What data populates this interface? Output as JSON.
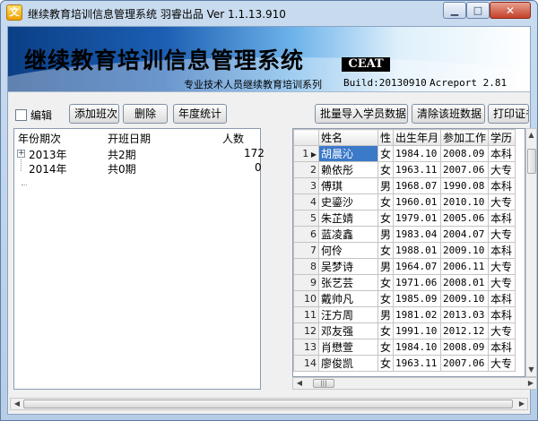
{
  "window": {
    "title": "继续教育培训信息管理系统  羽睿出品    Ver 1.1.13.910",
    "app_icon_glyph": "文"
  },
  "banner": {
    "title": "继续教育培训信息管理系统",
    "badge": "CEAT",
    "subtitle": "专业技术人员继续教育培训系列",
    "build": "Build:20130910",
    "acreport": "Acreport 2.81"
  },
  "toolbar": {
    "edit_label": "编辑",
    "add_class": "添加班次",
    "delete": "删除",
    "year_stats": "年度统计",
    "batch_import": "批量导入学员数据",
    "clear_class": "清除该班数据",
    "print_cert": "打印证书"
  },
  "left_table": {
    "headers": [
      "年份期次",
      "开班日期",
      "人数"
    ],
    "rows": [
      {
        "year": "2013年",
        "periods": "共2期",
        "count": "172"
      },
      {
        "year": "2014年",
        "periods": "共0期",
        "count": "0"
      }
    ]
  },
  "grid": {
    "headers": [
      "姓名",
      "性",
      "出生年月",
      "参加工作",
      "学历"
    ],
    "rows": [
      {
        "rn": "1",
        "name": "胡晨沁",
        "sex": "女",
        "birth": "1984.10",
        "work": "2008.09",
        "edu": "本科"
      },
      {
        "rn": "2",
        "name": "赖依彤",
        "sex": "女",
        "birth": "1963.11",
        "work": "2007.06",
        "edu": "大专"
      },
      {
        "rn": "3",
        "name": "傅琪",
        "sex": "男",
        "birth": "1968.07",
        "work": "1990.08",
        "edu": "本科"
      },
      {
        "rn": "4",
        "name": "史鎏沙",
        "sex": "女",
        "birth": "1960.01",
        "work": "2010.10",
        "edu": "大专"
      },
      {
        "rn": "5",
        "name": "朱芷婧",
        "sex": "女",
        "birth": "1979.01",
        "work": "2005.06",
        "edu": "本科"
      },
      {
        "rn": "6",
        "name": "蓝凌鑫",
        "sex": "男",
        "birth": "1983.04",
        "work": "2004.07",
        "edu": "大专"
      },
      {
        "rn": "7",
        "name": "何伶",
        "sex": "女",
        "birth": "1988.01",
        "work": "2009.10",
        "edu": "本科"
      },
      {
        "rn": "8",
        "name": "吴梦诗",
        "sex": "男",
        "birth": "1964.07",
        "work": "2006.11",
        "edu": "大专"
      },
      {
        "rn": "9",
        "name": "张艺芸",
        "sex": "女",
        "birth": "1971.06",
        "work": "2008.01",
        "edu": "大专"
      },
      {
        "rn": "10",
        "name": "戴帅凡",
        "sex": "女",
        "birth": "1985.09",
        "work": "2009.10",
        "edu": "本科"
      },
      {
        "rn": "11",
        "name": "汪方周",
        "sex": "男",
        "birth": "1981.02",
        "work": "2013.03",
        "edu": "本科"
      },
      {
        "rn": "12",
        "name": "邓友强",
        "sex": "女",
        "birth": "1991.10",
        "work": "2012.12",
        "edu": "大专"
      },
      {
        "rn": "13",
        "name": "肖懋萱",
        "sex": "女",
        "birth": "1984.10",
        "work": "2008.09",
        "edu": "本科"
      },
      {
        "rn": "14",
        "name": "廖俊凯",
        "sex": "女",
        "birth": "1963.11",
        "work": "2007.06",
        "edu": "大专"
      }
    ]
  }
}
